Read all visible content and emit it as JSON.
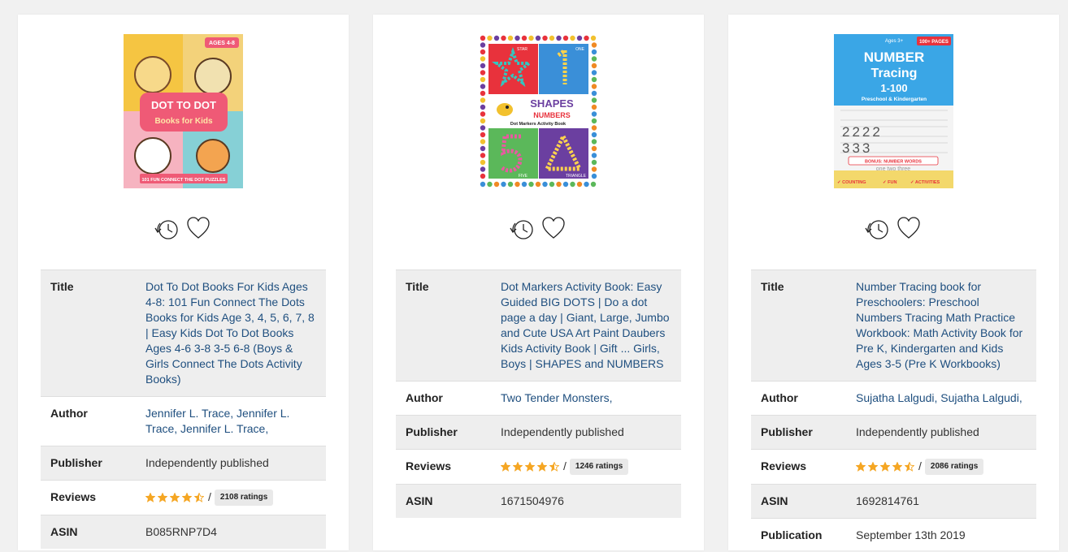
{
  "labels": {
    "title": "Title",
    "author": "Author",
    "publisher": "Publisher",
    "reviews": "Reviews",
    "asin": "ASIN",
    "publication": "Publication"
  },
  "books": [
    {
      "cover": {
        "ages": "AGES 4-8",
        "title_line1": "DOT TO DOT",
        "title_line2": "Books for Kids",
        "banner": "101 FUN CONNECT THE DOT PUZZLES"
      },
      "title": "Dot To Dot Books For Kids Ages 4-8: 101 Fun Connect The Dots Books for Kids Age 3, 4, 5, 6, 7, 8 | Easy Kids Dot To Dot Books Ages 4-6 3-8 3-5 6-8 (Boys & Girls Connect The Dots Activity Books)",
      "author": "Jennifer L. Trace, Jennifer L. Trace, Jennifer L. Trace,",
      "publisher": "Independently published",
      "rating": 4.5,
      "ratings_count": "2108 ratings",
      "slash": "/",
      "asin": "B085RNP7D4",
      "publication": ""
    },
    {
      "cover": {
        "star": "STAR",
        "one": "ONE",
        "title_line1": "SHAPES",
        "title_line2": "NUMBERS",
        "subtitle": "Dot Markers Activity Book",
        "five": "FIVE",
        "triangle": "TRIANGLE"
      },
      "title": "Dot Markers Activity Book: Easy Guided BIG DOTS | Do a dot page a day | Giant, Large, Jumbo and Cute USA Art Paint Daubers Kids Activity Book | Gift ... Girls, Boys | SHAPES and NUMBERS",
      "author": "Two Tender Monsters,",
      "publisher": "Independently published",
      "rating": 4.5,
      "ratings_count": "1246 ratings",
      "slash": "/",
      "asin": "1671504976"
    },
    {
      "cover": {
        "ages": "Ages 3+",
        "pages": "100+ PAGES",
        "title_line1": "NUMBER",
        "title_line2": "Tracing",
        "range": "1-100",
        "subtitle": "Preschool & Kindergarten",
        "bonus": "BONUS: NUMBER WORDS",
        "words": "one two three",
        "f1": "✓ COUNTING",
        "f2": "✓ FUN",
        "f3": "✓ ACTIVITIES"
      },
      "title": "Number Tracing book for Preschoolers: Preschool Numbers Tracing Math Practice Workbook: Math Activity Book for Pre K, Kindergarten and Kids Ages 3-5 (Pre K Workbooks)",
      "author": "Sujatha Lalgudi, Sujatha Lalgudi,",
      "publisher": "Independently published",
      "rating": 4.5,
      "ratings_count": "2086 ratings",
      "slash": "/",
      "asin": "1692814761",
      "publication": "September 13th 2019"
    }
  ],
  "icons": {
    "history": "history-clock-icon",
    "favorite": "heart-icon",
    "star": "star-icon"
  },
  "colors": {
    "link": "#1f4f7f",
    "star": "#f5a623",
    "shade": "#eeeeee",
    "page_bg": "#f1f1f1"
  }
}
